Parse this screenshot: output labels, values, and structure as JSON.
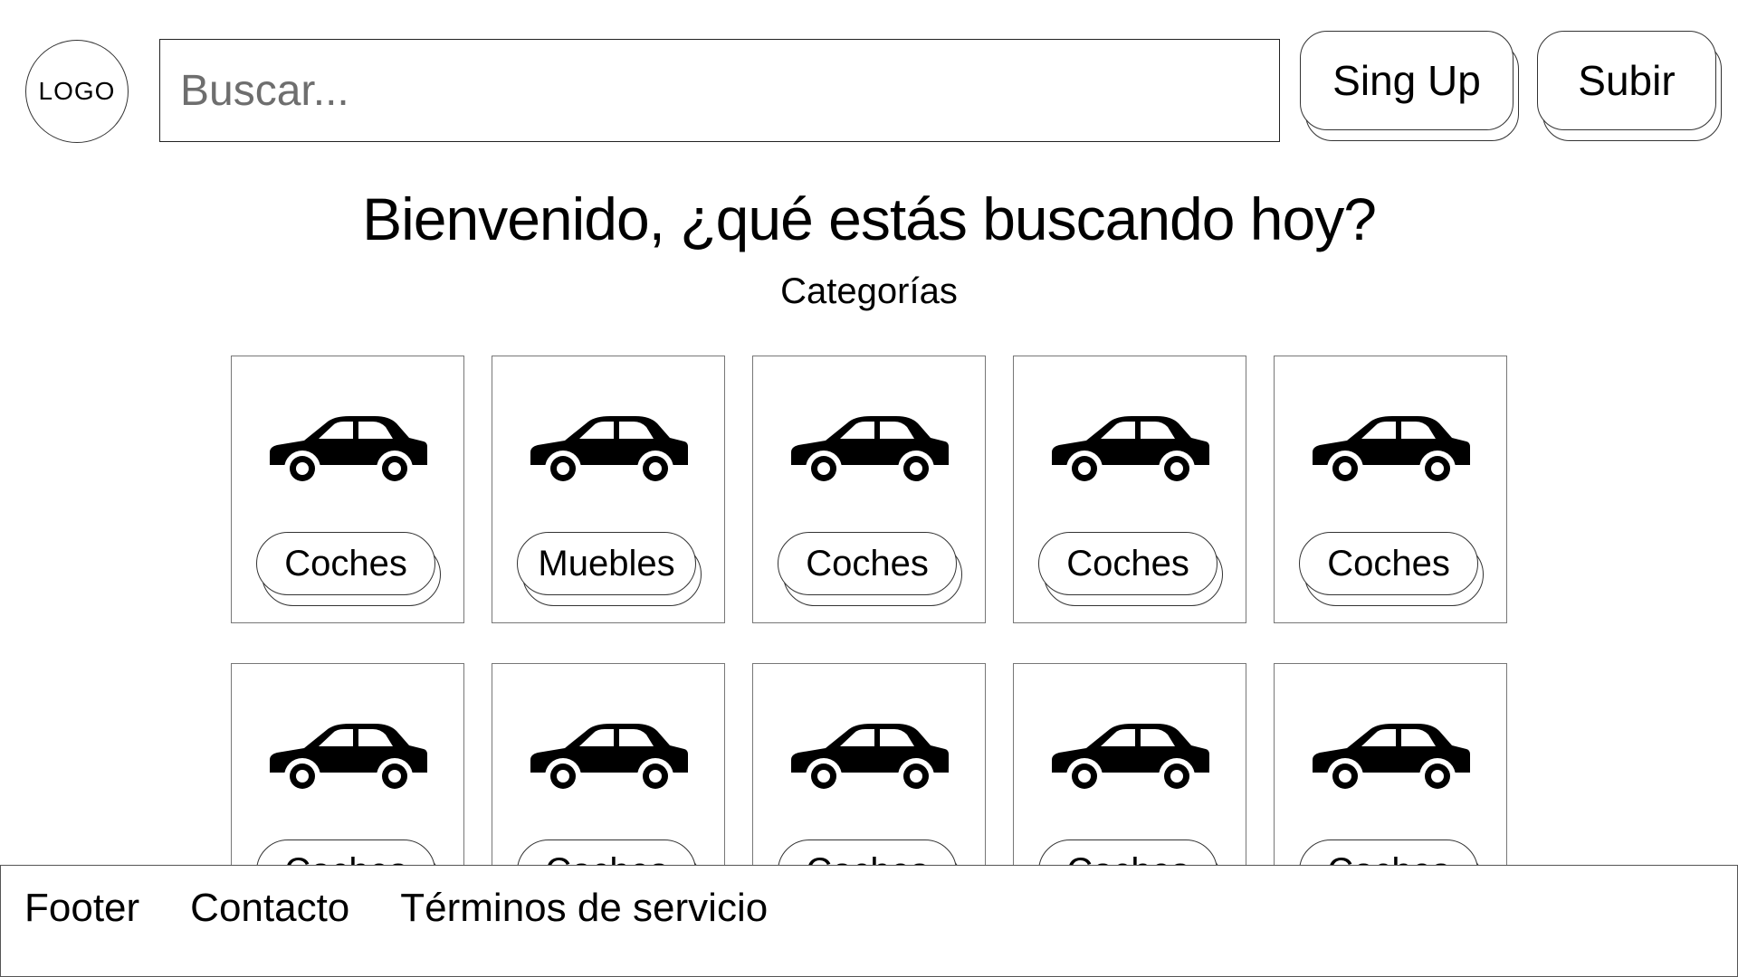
{
  "header": {
    "logo_text": "LOGO",
    "search_placeholder": "Buscar...",
    "signup_label": "Sing Up",
    "upload_label": "Subir"
  },
  "main": {
    "welcome": "Bienvenido, ¿qué estás buscando hoy?",
    "categories_title": "Categorías",
    "categories": [
      {
        "label": "Coches",
        "icon": "car-icon"
      },
      {
        "label": "Muebles",
        "icon": "car-icon"
      },
      {
        "label": "Coches",
        "icon": "car-icon"
      },
      {
        "label": "Coches",
        "icon": "car-icon"
      },
      {
        "label": "Coches",
        "icon": "car-icon"
      },
      {
        "label": "Coches",
        "icon": "car-icon"
      },
      {
        "label": "Coches",
        "icon": "car-icon"
      },
      {
        "label": "Coches",
        "icon": "car-icon"
      },
      {
        "label": "Coches",
        "icon": "car-icon"
      },
      {
        "label": "Coches",
        "icon": "car-icon"
      }
    ]
  },
  "footer": {
    "title": "Footer",
    "contact": "Contacto",
    "terms": "Términos de servicio"
  }
}
